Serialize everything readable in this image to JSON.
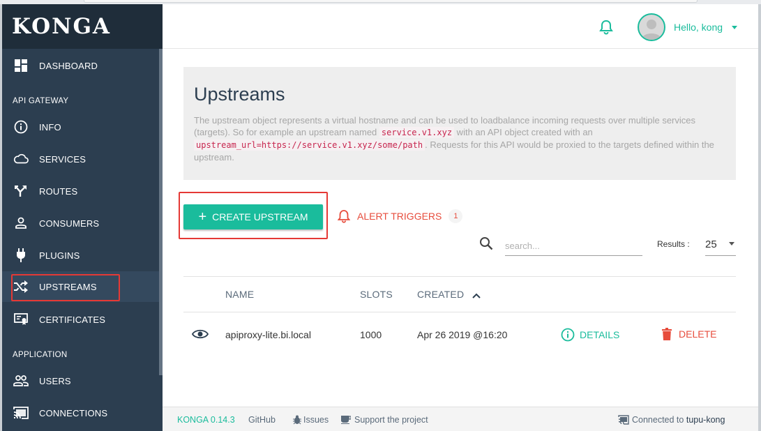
{
  "brand": {
    "logo_text": "KONGA"
  },
  "sidebar": {
    "sections": [
      {
        "title": "API GATEWAY"
      },
      {
        "title": "APPLICATION"
      }
    ],
    "items": [
      {
        "label": "DASHBOARD",
        "icon": "dashboard-icon"
      },
      {
        "label": "INFO",
        "icon": "info-icon"
      },
      {
        "label": "SERVICES",
        "icon": "cloud-icon"
      },
      {
        "label": "ROUTES",
        "icon": "routes-icon"
      },
      {
        "label": "CONSUMERS",
        "icon": "person-icon"
      },
      {
        "label": "PLUGINS",
        "icon": "plug-icon"
      },
      {
        "label": "UPSTREAMS",
        "icon": "shuffle-icon",
        "active": true
      },
      {
        "label": "CERTIFICATES",
        "icon": "certificate-icon"
      },
      {
        "label": "USERS",
        "icon": "users-icon"
      },
      {
        "label": "CONNECTIONS",
        "icon": "cast-icon"
      }
    ]
  },
  "header": {
    "greeting": "Hello, kong",
    "notification_icon": "bell-icon"
  },
  "page": {
    "title": "Upstreams",
    "description": {
      "part1": "The upstream object represents a virtual hostname and can be used to loadbalance incoming requests over multiple services (targets). So for example an upstream named ",
      "code1": "service.v1.xyz",
      "part2": " with an API object created with an ",
      "code2": "upstream_url=https://service.v1.xyz/some/path",
      "part3": ". Requests for this API would be proxied to the targets defined within the upstream."
    }
  },
  "actions": {
    "create_label": "CREATE UPSTREAM",
    "alert_label": "ALERT TRIGGERS",
    "alert_count": "1"
  },
  "search": {
    "placeholder": "search..."
  },
  "results": {
    "label": "Results :",
    "value": "25"
  },
  "table": {
    "columns": [
      "NAME",
      "SLOTS",
      "CREATED"
    ],
    "sort_column": "CREATED",
    "sort_direction": "asc",
    "rows": [
      {
        "name": "apiproxy-lite.bi.local",
        "slots": "1000",
        "created": "Apr 26 2019 @16:20",
        "details_label": "DETAILS",
        "delete_label": "DELETE"
      }
    ]
  },
  "footer": {
    "version": "KONGA 0.14.3",
    "github": "GitHub",
    "issues": "Issues",
    "support": "Support the project",
    "connected_prefix": "Connected to",
    "connected_name": "tupu-kong"
  },
  "colors": {
    "sidebar_bg": "#2c3e50",
    "accent": "#1abc9c",
    "danger": "#e74c3c",
    "highlight_box": "#e53935"
  }
}
